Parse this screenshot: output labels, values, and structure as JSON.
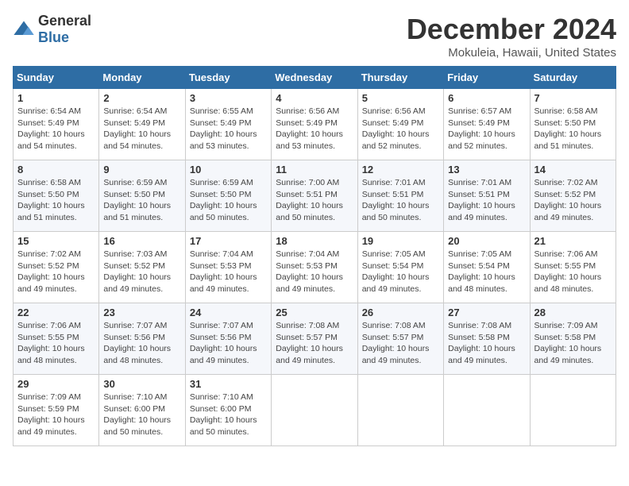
{
  "logo": {
    "general": "General",
    "blue": "Blue"
  },
  "title": "December 2024",
  "location": "Mokuleia, Hawaii, United States",
  "days_of_week": [
    "Sunday",
    "Monday",
    "Tuesday",
    "Wednesday",
    "Thursday",
    "Friday",
    "Saturday"
  ],
  "weeks": [
    [
      {
        "day": "1",
        "sunrise": "6:54 AM",
        "sunset": "5:49 PM",
        "daylight": "10 hours and 54 minutes."
      },
      {
        "day": "2",
        "sunrise": "6:54 AM",
        "sunset": "5:49 PM",
        "daylight": "10 hours and 54 minutes."
      },
      {
        "day": "3",
        "sunrise": "6:55 AM",
        "sunset": "5:49 PM",
        "daylight": "10 hours and 53 minutes."
      },
      {
        "day": "4",
        "sunrise": "6:56 AM",
        "sunset": "5:49 PM",
        "daylight": "10 hours and 53 minutes."
      },
      {
        "day": "5",
        "sunrise": "6:56 AM",
        "sunset": "5:49 PM",
        "daylight": "10 hours and 52 minutes."
      },
      {
        "day": "6",
        "sunrise": "6:57 AM",
        "sunset": "5:49 PM",
        "daylight": "10 hours and 52 minutes."
      },
      {
        "day": "7",
        "sunrise": "6:58 AM",
        "sunset": "5:50 PM",
        "daylight": "10 hours and 51 minutes."
      }
    ],
    [
      {
        "day": "8",
        "sunrise": "6:58 AM",
        "sunset": "5:50 PM",
        "daylight": "10 hours and 51 minutes."
      },
      {
        "day": "9",
        "sunrise": "6:59 AM",
        "sunset": "5:50 PM",
        "daylight": "10 hours and 51 minutes."
      },
      {
        "day": "10",
        "sunrise": "6:59 AM",
        "sunset": "5:50 PM",
        "daylight": "10 hours and 50 minutes."
      },
      {
        "day": "11",
        "sunrise": "7:00 AM",
        "sunset": "5:51 PM",
        "daylight": "10 hours and 50 minutes."
      },
      {
        "day": "12",
        "sunrise": "7:01 AM",
        "sunset": "5:51 PM",
        "daylight": "10 hours and 50 minutes."
      },
      {
        "day": "13",
        "sunrise": "7:01 AM",
        "sunset": "5:51 PM",
        "daylight": "10 hours and 49 minutes."
      },
      {
        "day": "14",
        "sunrise": "7:02 AM",
        "sunset": "5:52 PM",
        "daylight": "10 hours and 49 minutes."
      }
    ],
    [
      {
        "day": "15",
        "sunrise": "7:02 AM",
        "sunset": "5:52 PM",
        "daylight": "10 hours and 49 minutes."
      },
      {
        "day": "16",
        "sunrise": "7:03 AM",
        "sunset": "5:52 PM",
        "daylight": "10 hours and 49 minutes."
      },
      {
        "day": "17",
        "sunrise": "7:04 AM",
        "sunset": "5:53 PM",
        "daylight": "10 hours and 49 minutes."
      },
      {
        "day": "18",
        "sunrise": "7:04 AM",
        "sunset": "5:53 PM",
        "daylight": "10 hours and 49 minutes."
      },
      {
        "day": "19",
        "sunrise": "7:05 AM",
        "sunset": "5:54 PM",
        "daylight": "10 hours and 49 minutes."
      },
      {
        "day": "20",
        "sunrise": "7:05 AM",
        "sunset": "5:54 PM",
        "daylight": "10 hours and 48 minutes."
      },
      {
        "day": "21",
        "sunrise": "7:06 AM",
        "sunset": "5:55 PM",
        "daylight": "10 hours and 48 minutes."
      }
    ],
    [
      {
        "day": "22",
        "sunrise": "7:06 AM",
        "sunset": "5:55 PM",
        "daylight": "10 hours and 48 minutes."
      },
      {
        "day": "23",
        "sunrise": "7:07 AM",
        "sunset": "5:56 PM",
        "daylight": "10 hours and 48 minutes."
      },
      {
        "day": "24",
        "sunrise": "7:07 AM",
        "sunset": "5:56 PM",
        "daylight": "10 hours and 49 minutes."
      },
      {
        "day": "25",
        "sunrise": "7:08 AM",
        "sunset": "5:57 PM",
        "daylight": "10 hours and 49 minutes."
      },
      {
        "day": "26",
        "sunrise": "7:08 AM",
        "sunset": "5:57 PM",
        "daylight": "10 hours and 49 minutes."
      },
      {
        "day": "27",
        "sunrise": "7:08 AM",
        "sunset": "5:58 PM",
        "daylight": "10 hours and 49 minutes."
      },
      {
        "day": "28",
        "sunrise": "7:09 AM",
        "sunset": "5:58 PM",
        "daylight": "10 hours and 49 minutes."
      }
    ],
    [
      {
        "day": "29",
        "sunrise": "7:09 AM",
        "sunset": "5:59 PM",
        "daylight": "10 hours and 49 minutes."
      },
      {
        "day": "30",
        "sunrise": "7:10 AM",
        "sunset": "6:00 PM",
        "daylight": "10 hours and 50 minutes."
      },
      {
        "day": "31",
        "sunrise": "7:10 AM",
        "sunset": "6:00 PM",
        "daylight": "10 hours and 50 minutes."
      },
      null,
      null,
      null,
      null
    ]
  ]
}
